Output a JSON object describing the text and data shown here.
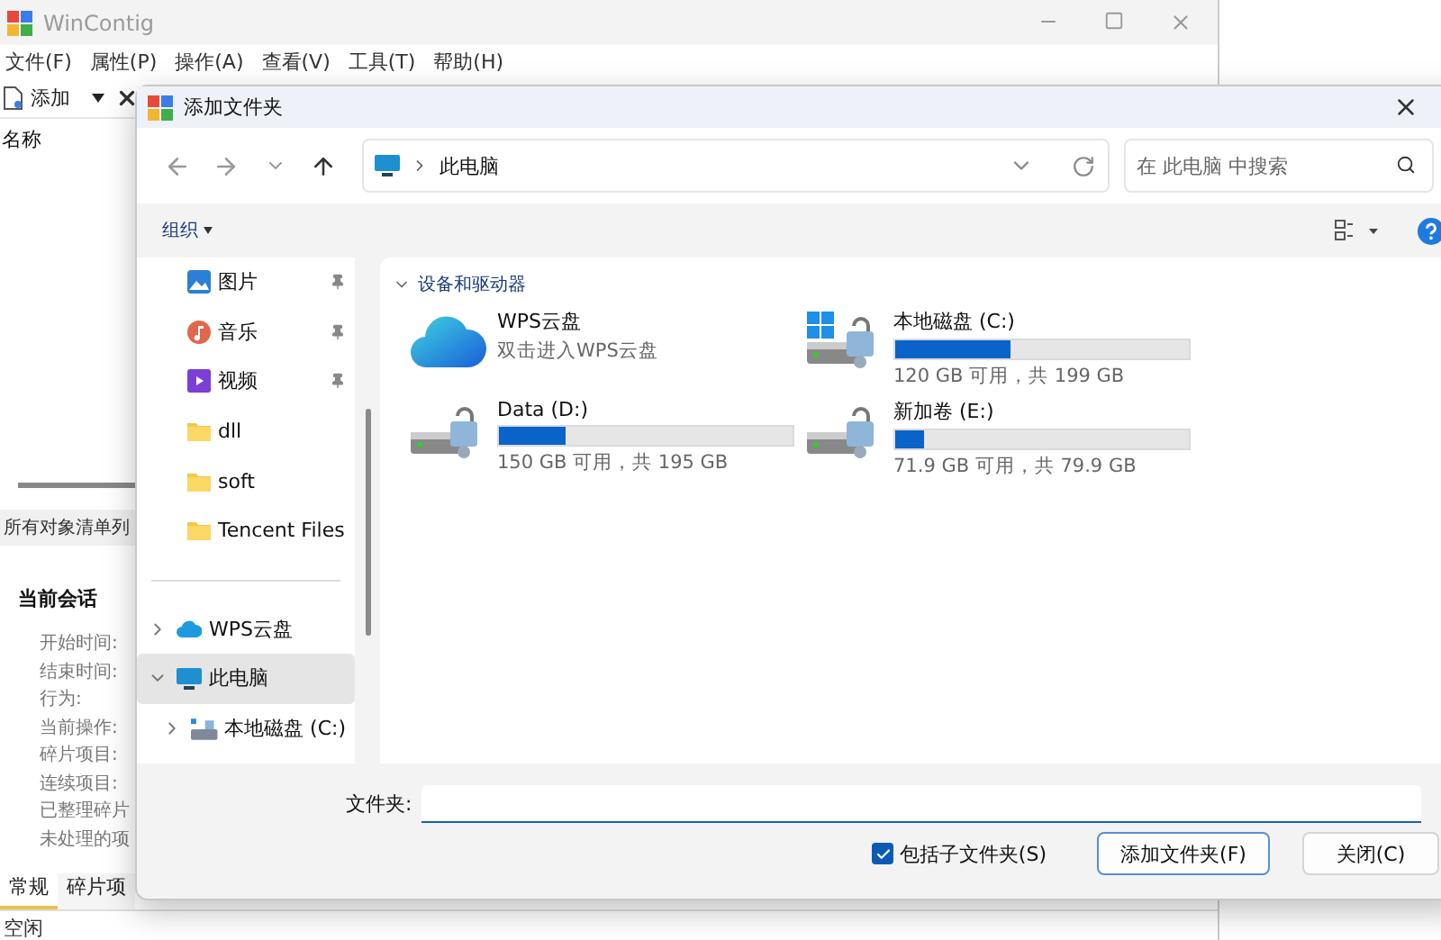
{
  "main_window": {
    "title": "WinContig",
    "menu": [
      "文件(F)",
      "属性(P)",
      "操作(A)",
      "查看(V)",
      "工具(T)",
      "帮助(H)"
    ],
    "toolbar": {
      "add_label": "添加"
    },
    "list_header": "名称",
    "panel_tab": "所有对象清单列",
    "session_title": "当前会话",
    "session_fields": [
      "开始时间:",
      "结束时间:",
      "行为:",
      "当前操作:",
      "碎片项目:",
      "连续项目:",
      "已整理碎片",
      "未处理的项"
    ],
    "bottom_tabs": [
      {
        "label": "常规",
        "selected": true
      },
      {
        "label": "碎片项",
        "selected": false
      }
    ],
    "status_bar": "空闲"
  },
  "dialog": {
    "title": "添加文件夹",
    "address": {
      "path": "此电脑"
    },
    "search": {
      "placeholder": "在 此电脑 中搜索"
    },
    "command_bar": {
      "organize": "组织"
    },
    "nav": [
      {
        "label": "图片",
        "kind": "pictures",
        "pinned": true,
        "selected": false
      },
      {
        "label": "音乐",
        "kind": "music",
        "pinned": true,
        "selected": false
      },
      {
        "label": "视频",
        "kind": "videos",
        "pinned": true,
        "selected": false
      },
      {
        "label": "dll",
        "kind": "folder",
        "pinned": false,
        "selected": false
      },
      {
        "label": "soft",
        "kind": "folder",
        "pinned": false,
        "selected": false
      },
      {
        "label": "Tencent Files",
        "kind": "folder",
        "pinned": false,
        "selected": false
      },
      {
        "kind": "divider"
      },
      {
        "label": "WPS云盘",
        "kind": "cloud",
        "expanded": false,
        "selected": false
      },
      {
        "label": "此电脑",
        "kind": "pc",
        "expanded": true,
        "selected": true,
        "children": [
          {
            "label": "本地磁盘 (C:)",
            "kind": "drive",
            "expanded": false,
            "selected": false
          }
        ]
      }
    ],
    "section": {
      "title": "设备和驱动器",
      "expanded": true
    },
    "drives": [
      {
        "kind": "cloud",
        "name": "WPS云盘",
        "subtitle": "双击进入WPS云盘"
      },
      {
        "kind": "system",
        "name": "本地磁盘 (C:)",
        "level": 0.39,
        "usage": "120 GB 可用，共 199 GB"
      },
      {
        "kind": "disk",
        "name": "Data (D:)",
        "level": 0.23,
        "usage": "150 GB 可用，共 195 GB"
      },
      {
        "kind": "disk",
        "name": "新加卷 (E:)",
        "level": 0.1,
        "usage": "71.9 GB 可用，共 79.9 GB"
      }
    ],
    "folder_label": "文件夹:",
    "include_subfolders": {
      "label": "包括子文件夹(S)",
      "checked": true
    },
    "buttons": [
      {
        "label": "添加文件夹(F)",
        "kind": "primary"
      },
      {
        "label": "关闭(C)",
        "kind": "normal"
      }
    ]
  }
}
